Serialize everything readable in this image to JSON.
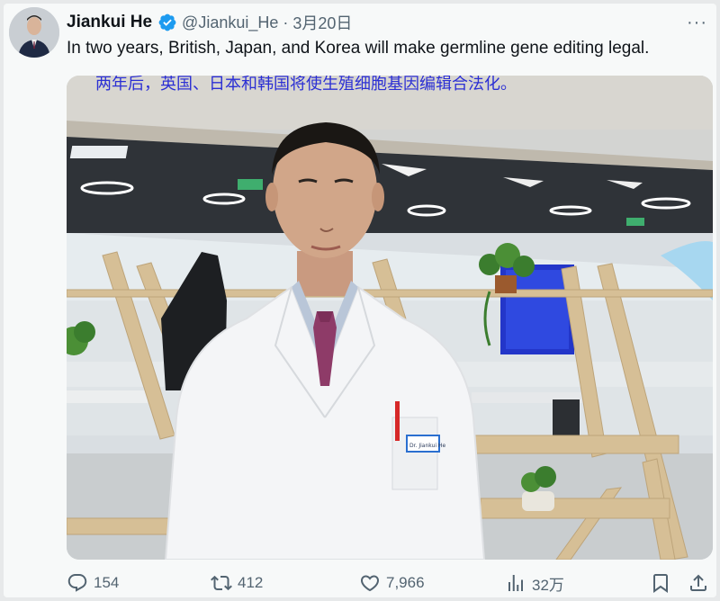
{
  "tweet": {
    "author_name": "Jiankui He",
    "handle": "@Jiankui_He",
    "separator": "·",
    "date": "3月20日",
    "more_label": "···",
    "text": "In two years, British, Japan, and Korea will make germline gene editing legal.",
    "image_caption": "两年后，英国、日本和韩国将使生殖细胞基因编辑合法化。"
  },
  "actions": {
    "replies": "154",
    "retweets": "412",
    "likes": "7,966",
    "views": "32万"
  },
  "badge": {
    "text": "Dr. Jiankui He"
  },
  "colors": {
    "verified": "#1d9bf0",
    "caption": "#2b2fd4",
    "secondary_text": "#536471"
  },
  "icons": [
    "verified-badge-icon",
    "more-icon",
    "reply-icon",
    "retweet-icon",
    "like-icon",
    "views-icon",
    "bookmark-icon",
    "share-icon"
  ]
}
